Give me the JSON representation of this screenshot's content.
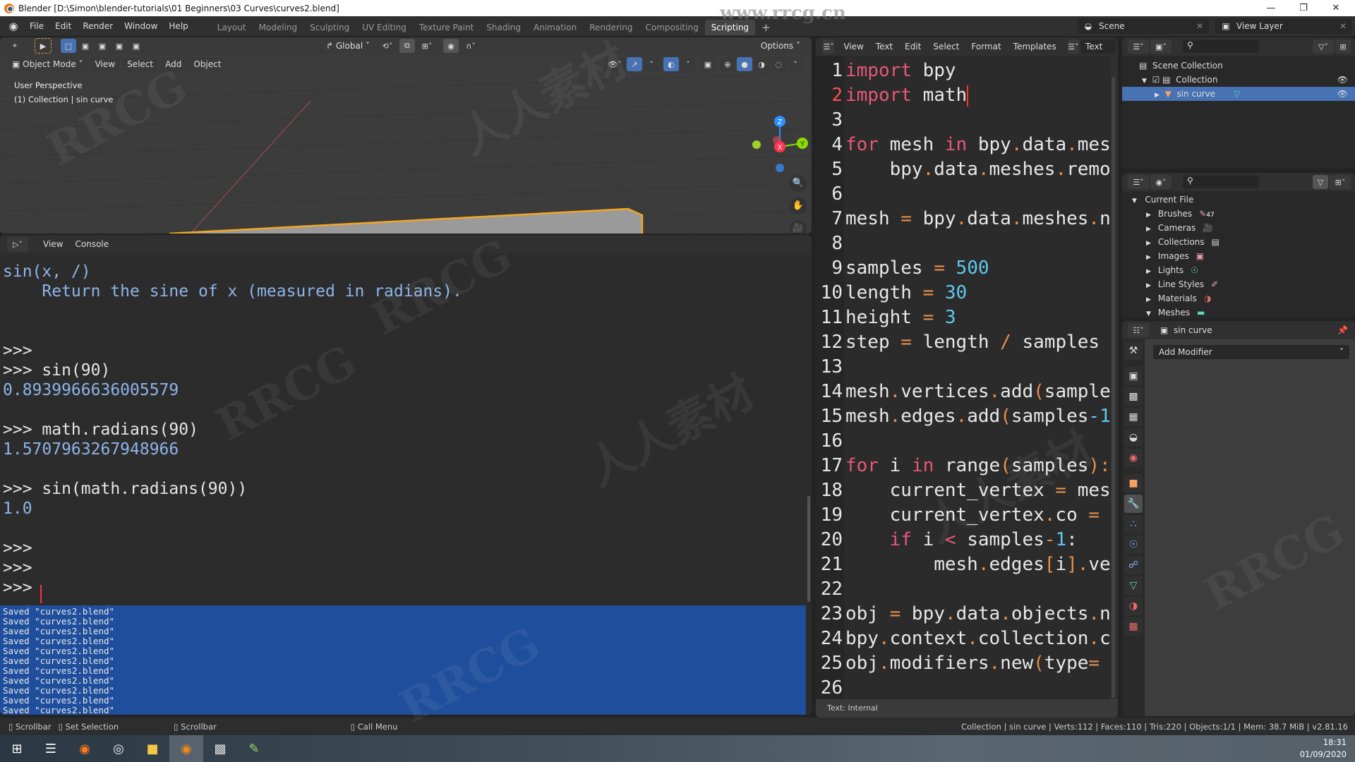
{
  "window": {
    "title": "Blender [D:\\Simon\\blender-tutorials\\01 Beginners\\03 Curves\\curves2.blend]",
    "controls": [
      "minimize",
      "restore",
      "close"
    ]
  },
  "menu": [
    "File",
    "Edit",
    "Render",
    "Window",
    "Help"
  ],
  "workspaces": [
    {
      "label": "Layout",
      "active": false
    },
    {
      "label": "Modeling",
      "active": false
    },
    {
      "label": "Sculpting",
      "active": false
    },
    {
      "label": "UV Editing",
      "active": false
    },
    {
      "label": "Texture Paint",
      "active": false
    },
    {
      "label": "Shading",
      "active": false
    },
    {
      "label": "Animation",
      "active": false
    },
    {
      "label": "Rendering",
      "active": false
    },
    {
      "label": "Compositing",
      "active": false
    },
    {
      "label": "Scripting",
      "active": true
    }
  ],
  "add_workspace": "+",
  "scene": {
    "label": "Scene",
    "view_layer": "View Layer"
  },
  "viewport": {
    "orientation": "Global",
    "options_label": "Options",
    "mode": "Object Mode",
    "menus": [
      "View",
      "Select",
      "Add",
      "Object"
    ],
    "overlay_lines": [
      "User Perspective",
      "(1) Collection | sin curve"
    ],
    "gizmo_axes": {
      "x": "X",
      "y": "Y",
      "z": "Z"
    },
    "colors": {
      "x": "#ff3352",
      "y": "#8bdc00",
      "z": "#2890ff",
      "selection": "#f5a623"
    }
  },
  "console": {
    "menus": [
      "View",
      "Console"
    ],
    "lines": [
      {
        "text": "sin(x, /)",
        "style": "blue"
      },
      {
        "text": "    Return the sine of x (measured in radians).",
        "style": "blue"
      },
      {
        "text": "",
        "style": "white"
      },
      {
        "text": "",
        "style": "white"
      },
      {
        "text": ">>> ",
        "style": "white"
      },
      {
        "text": ">>> sin(90)",
        "style": "white"
      },
      {
        "text": "0.8939966636005579",
        "style": "blue"
      },
      {
        "text": "",
        "style": "white"
      },
      {
        "text": ">>> math.radians(90)",
        "style": "white"
      },
      {
        "text": "1.5707963267948966",
        "style": "blue"
      },
      {
        "text": "",
        "style": "white"
      },
      {
        "text": ">>> sin(math.radians(90))",
        "style": "white"
      },
      {
        "text": "1.0",
        "style": "blue"
      },
      {
        "text": "",
        "style": "white"
      },
      {
        "text": ">>> ",
        "style": "white"
      },
      {
        "text": ">>> ",
        "style": "white"
      },
      {
        "text": ">>> ",
        "style": "white"
      }
    ],
    "info_log": [
      "Saved \"curves2.blend\"",
      "Saved \"curves2.blend\"",
      "Saved \"curves2.blend\"",
      "Saved \"curves2.blend\"",
      "Saved \"curves2.blend\"",
      "Saved \"curves2.blend\"",
      "Saved \"curves2.blend\"",
      "Saved \"curves2.blend\"",
      "Saved \"curves2.blend\"",
      "Saved \"curves2.blend\"",
      "Saved \"curves2.blend\""
    ]
  },
  "text_editor": {
    "menus": [
      "View",
      "Text",
      "Edit",
      "Select",
      "Format",
      "Templates"
    ],
    "datablock": "Text",
    "footer": "Text: Internal",
    "current_line": 2,
    "lines": [
      [
        {
          "t": "import",
          "c": "kw"
        },
        {
          "t": " bpy",
          "c": ""
        }
      ],
      [
        {
          "t": "import",
          "c": "kw"
        },
        {
          "t": " math",
          "c": ""
        }
      ],
      [],
      [
        {
          "t": "for",
          "c": "kw"
        },
        {
          "t": " mesh ",
          "c": ""
        },
        {
          "t": "in",
          "c": "kw"
        },
        {
          "t": " bpy",
          "c": ""
        },
        {
          "t": ".",
          "c": "op"
        },
        {
          "t": "data",
          "c": ""
        },
        {
          "t": ".",
          "c": "op"
        },
        {
          "t": "mes",
          "c": ""
        }
      ],
      [
        {
          "t": "    bpy",
          "c": ""
        },
        {
          "t": ".",
          "c": "op"
        },
        {
          "t": "data",
          "c": ""
        },
        {
          "t": ".",
          "c": "op"
        },
        {
          "t": "meshes",
          "c": ""
        },
        {
          "t": ".",
          "c": "op"
        },
        {
          "t": "remo",
          "c": ""
        }
      ],
      [],
      [
        {
          "t": "mesh ",
          "c": ""
        },
        {
          "t": "=",
          "c": "op"
        },
        {
          "t": " bpy",
          "c": ""
        },
        {
          "t": ".",
          "c": "op"
        },
        {
          "t": "data",
          "c": ""
        },
        {
          "t": ".",
          "c": "op"
        },
        {
          "t": "meshes",
          "c": ""
        },
        {
          "t": ".",
          "c": "op"
        },
        {
          "t": "n",
          "c": ""
        }
      ],
      [],
      [
        {
          "t": "samples ",
          "c": ""
        },
        {
          "t": "=",
          "c": "op"
        },
        {
          "t": " ",
          "c": ""
        },
        {
          "t": "500",
          "c": "num"
        }
      ],
      [
        {
          "t": "length ",
          "c": ""
        },
        {
          "t": "=",
          "c": "op"
        },
        {
          "t": " ",
          "c": ""
        },
        {
          "t": "30",
          "c": "num"
        }
      ],
      [
        {
          "t": "height ",
          "c": ""
        },
        {
          "t": "=",
          "c": "op"
        },
        {
          "t": " ",
          "c": ""
        },
        {
          "t": "3",
          "c": "num"
        }
      ],
      [
        {
          "t": "step ",
          "c": ""
        },
        {
          "t": "=",
          "c": "op"
        },
        {
          "t": " length ",
          "c": ""
        },
        {
          "t": "/",
          "c": "op"
        },
        {
          "t": " samples",
          "c": ""
        }
      ],
      [],
      [
        {
          "t": "mesh",
          "c": ""
        },
        {
          "t": ".",
          "c": "op"
        },
        {
          "t": "vertices",
          "c": ""
        },
        {
          "t": ".",
          "c": "op"
        },
        {
          "t": "add",
          "c": ""
        },
        {
          "t": "(",
          "c": "op"
        },
        {
          "t": "sample",
          "c": ""
        }
      ],
      [
        {
          "t": "mesh",
          "c": ""
        },
        {
          "t": ".",
          "c": "op"
        },
        {
          "t": "edges",
          "c": ""
        },
        {
          "t": ".",
          "c": "op"
        },
        {
          "t": "add",
          "c": ""
        },
        {
          "t": "(",
          "c": "op"
        },
        {
          "t": "samples",
          "c": ""
        },
        {
          "t": "-1",
          "c": "num"
        }
      ],
      [],
      [
        {
          "t": "for",
          "c": "kw"
        },
        {
          "t": " i ",
          "c": ""
        },
        {
          "t": "in",
          "c": "kw"
        },
        {
          "t": " range",
          "c": ""
        },
        {
          "t": "(",
          "c": "op"
        },
        {
          "t": "samples",
          "c": ""
        },
        {
          "t": "):",
          "c": "op"
        }
      ],
      [
        {
          "t": "    current_vertex ",
          "c": ""
        },
        {
          "t": "=",
          "c": "op"
        },
        {
          "t": " mes",
          "c": ""
        }
      ],
      [
        {
          "t": "    current_vertex",
          "c": ""
        },
        {
          "t": ".",
          "c": "op"
        },
        {
          "t": "co ",
          "c": ""
        },
        {
          "t": "=",
          "c": "op"
        }
      ],
      [
        {
          "t": "    ",
          "c": ""
        },
        {
          "t": "if",
          "c": "kw"
        },
        {
          "t": " i ",
          "c": ""
        },
        {
          "t": "<",
          "c": "kw"
        },
        {
          "t": " samples",
          "c": ""
        },
        {
          "t": "-",
          "c": "op"
        },
        {
          "t": "1",
          "c": "num"
        },
        {
          "t": ":",
          "c": ""
        }
      ],
      [
        {
          "t": "        mesh",
          "c": ""
        },
        {
          "t": ".",
          "c": "op"
        },
        {
          "t": "edges",
          "c": ""
        },
        {
          "t": "[",
          "c": "op"
        },
        {
          "t": "i",
          "c": ""
        },
        {
          "t": "]",
          "c": "op"
        },
        {
          "t": ".",
          "c": "op"
        },
        {
          "t": "ve",
          "c": ""
        }
      ],
      [],
      [
        {
          "t": "obj ",
          "c": ""
        },
        {
          "t": "=",
          "c": "op"
        },
        {
          "t": " bpy",
          "c": ""
        },
        {
          "t": ".",
          "c": "op"
        },
        {
          "t": "data",
          "c": ""
        },
        {
          "t": ".",
          "c": "op"
        },
        {
          "t": "objects",
          "c": ""
        },
        {
          "t": ".",
          "c": "op"
        },
        {
          "t": "n",
          "c": ""
        }
      ],
      [
        {
          "t": "bpy",
          "c": ""
        },
        {
          "t": ".",
          "c": "op"
        },
        {
          "t": "context",
          "c": ""
        },
        {
          "t": ".",
          "c": "op"
        },
        {
          "t": "collection",
          "c": ""
        },
        {
          "t": ".",
          "c": "op"
        },
        {
          "t": "c",
          "c": ""
        }
      ],
      [
        {
          "t": "obj",
          "c": ""
        },
        {
          "t": ".",
          "c": "op"
        },
        {
          "t": "modifiers",
          "c": ""
        },
        {
          "t": ".",
          "c": "op"
        },
        {
          "t": "new",
          "c": ""
        },
        {
          "t": "(",
          "c": "op"
        },
        {
          "t": "type",
          "c": ""
        },
        {
          "t": "=",
          "c": "op"
        }
      ],
      []
    ]
  },
  "outliner": {
    "rows": [
      {
        "label": "Scene Collection",
        "depth": 0,
        "selected": false
      },
      {
        "label": "Collection",
        "depth": 1,
        "selected": false
      },
      {
        "label": "sin curve",
        "depth": 2,
        "selected": true
      }
    ]
  },
  "blend_file": {
    "root": "Current File",
    "items": [
      {
        "label": "Brushes",
        "badge": "47",
        "expanded": false
      },
      {
        "label": "Cameras",
        "expanded": false
      },
      {
        "label": "Collections",
        "expanded": false
      },
      {
        "label": "Images",
        "expanded": false
      },
      {
        "label": "Lights",
        "expanded": false
      },
      {
        "label": "Line Styles",
        "expanded": false
      },
      {
        "label": "Materials",
        "expanded": false
      },
      {
        "label": "Meshes",
        "expanded": true
      }
    ]
  },
  "properties": {
    "object_name": "sin curve",
    "add_modifier_label": "Add Modifier",
    "tabs": [
      "tool",
      "render",
      "output",
      "view-layer",
      "scene",
      "world",
      "object",
      "modifiers",
      "particles",
      "physics",
      "constraints",
      "data",
      "material",
      "texture"
    ],
    "active_tab": "modifiers"
  },
  "status_bar": {
    "hints": [
      {
        "icon": "mouse-left-icon",
        "label": "Scrollbar"
      },
      {
        "icon": "mouse-drag-icon",
        "label": "Set Selection"
      },
      {
        "icon": "mouse-middle-icon",
        "label": "Scrollbar"
      },
      {
        "icon": "mouse-right-icon",
        "label": "Call Menu"
      }
    ],
    "stats": "Collection | sin curve | Verts:112 | Faces:110 | Tris:220 | Objects:1/1 | Mem: 38.7 MiB | v2.81.16"
  },
  "taskbar": {
    "apps": [
      "start",
      "task-view",
      "firefox",
      "obs",
      "file-explorer",
      "blender",
      "terminal",
      "notepad"
    ],
    "active_app": "blender",
    "time": "18:31",
    "date": "01/09/2020"
  },
  "watermarks": [
    "RRCG",
    "人人素材",
    "www.rrcg.cn"
  ]
}
